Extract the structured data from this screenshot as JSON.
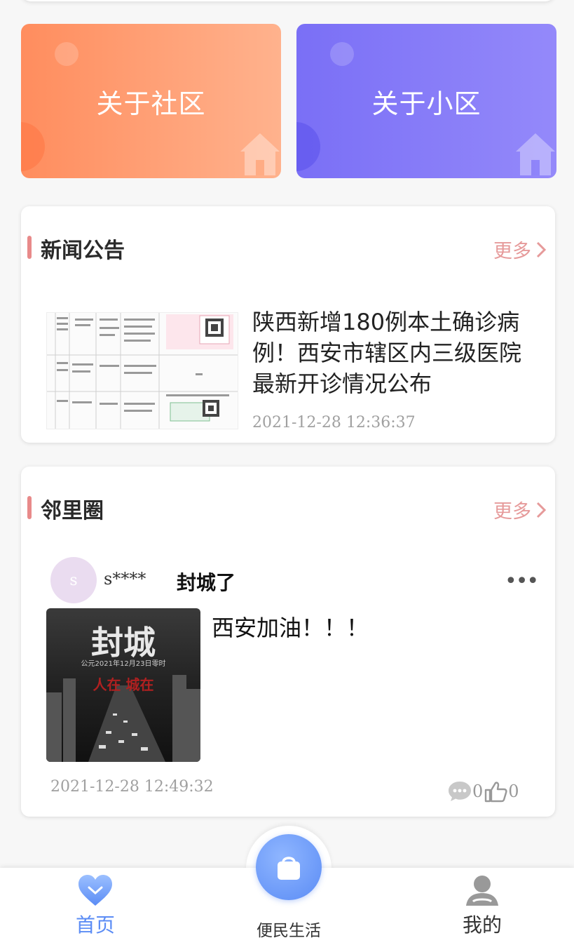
{
  "tiles": {
    "community": {
      "label": "关于社区",
      "colors": [
        "#ff8d5e",
        "#ffb28d"
      ]
    },
    "estate": {
      "label": "关于小区",
      "colors": [
        "#7a6ff6",
        "#9489fa"
      ]
    }
  },
  "news": {
    "section_title": "新闻公告",
    "more_label": "更多",
    "item": {
      "title": "陕西新增180例本土确诊病例！西安市辖区内三级医院最新开诊情况公布",
      "time": "2021-12-28 12:36:37"
    }
  },
  "circle": {
    "section_title": "邻里圈",
    "more_label": "更多",
    "post": {
      "avatar_letter": "s",
      "username": "s****",
      "title": "封城了",
      "content": "西安加油！！！",
      "time": "2021-12-28 12:49:32",
      "comments": "0",
      "likes": "0",
      "image": {
        "big_text": "封城",
        "sub_text": "公元2021年12月23日零时",
        "red_text": "人在 城在"
      }
    }
  },
  "tabbar": {
    "home": "首页",
    "life": "便民生活",
    "mine": "我的",
    "active_color": "#5b8cf5"
  },
  "icons": {
    "more": "chevron-right-icon",
    "comment": "comment-bubble-icon",
    "like": "thumb-up-icon",
    "home": "heart-icon",
    "life": "shopping-bag-icon",
    "mine": "user-icon",
    "menu": "more-dots-icon",
    "tile": "house-icon"
  }
}
